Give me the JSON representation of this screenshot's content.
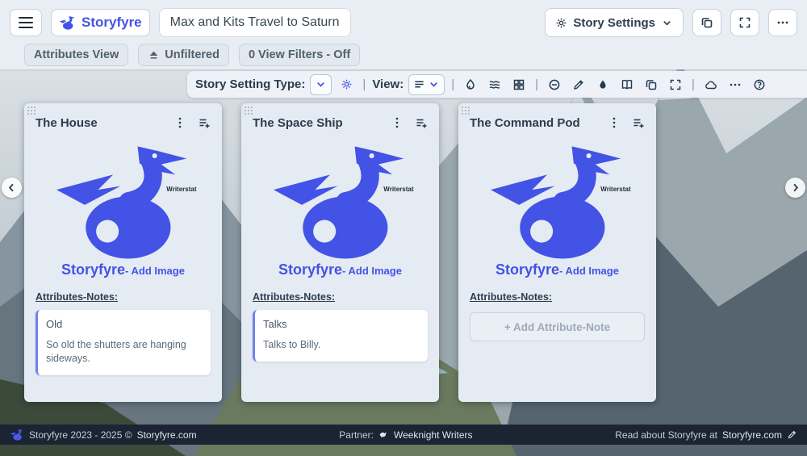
{
  "header": {
    "brand_label": "Storyfyre",
    "doc_title": "Max and Kits Travel to Saturn",
    "story_settings": "Story Settings"
  },
  "filters_bar": {
    "attributes_view": "Attributes View",
    "unfiltered": "Unfiltered",
    "view_filters": "0 View Filters - Off"
  },
  "toolbar": {
    "story_setting_type": "Story Setting Type:",
    "view": "View:",
    "divider": "|",
    "icon_names": [
      "chevron-down",
      "shape-settings",
      "list",
      "flame",
      "waves",
      "grid",
      "minus-circle",
      "pencil",
      "droplet",
      "book-open",
      "copy",
      "fullscreen",
      "cloud",
      "more-horizontal",
      "help"
    ]
  },
  "cards": [
    {
      "title": "The House",
      "watermark": "Writerstat",
      "brand": "Storyfyre",
      "add_image": "- Add Image",
      "notes_label": "Attributes-Notes:",
      "note": {
        "title": "Old",
        "body": "So old the shutters are hanging sideways."
      }
    },
    {
      "title": "The Space Ship",
      "watermark": "Writerstat",
      "brand": "Storyfyre",
      "add_image": "- Add Image",
      "notes_label": "Attributes-Notes:",
      "note": {
        "title": "Talks",
        "body": "Talks to Billy."
      }
    },
    {
      "title": "The Command Pod",
      "watermark": "Writerstat",
      "brand": "Storyfyre",
      "add_image": "- Add Image",
      "notes_label": "Attributes-Notes:",
      "add_note_button": "+ Add Attribute-Note"
    }
  ],
  "footer": {
    "copyright": "Storyfyre 2023 - 2025 ©",
    "site_link": "Storyfyre.com",
    "partner_label": "Partner:",
    "partner_name": "Weeknight Writers",
    "read_about": "Read about Storyfyre at",
    "read_link": "Storyfyre.com"
  },
  "colors": {
    "accent": "#4353e6",
    "ink": "#2d3d4d",
    "header_bg": "#e9eef4",
    "card_bg": "#e5ebf2",
    "note_border": "#6f83ea",
    "footer_bg": "#1a2432"
  }
}
